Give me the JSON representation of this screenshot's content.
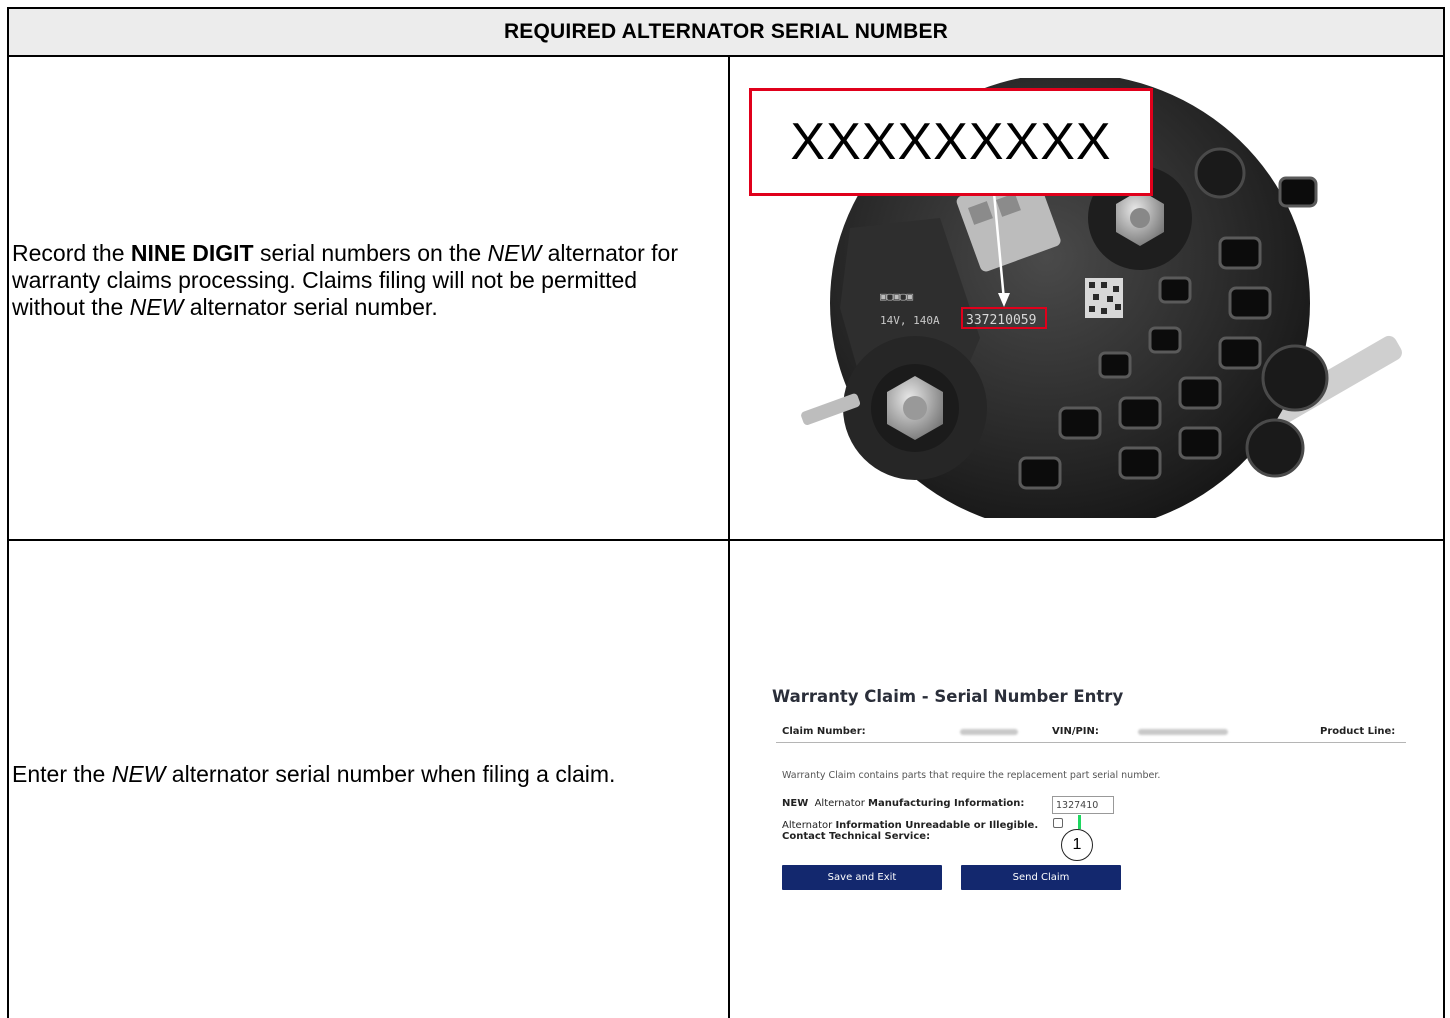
{
  "header": {
    "title": "REQUIRED ALTERNATOR SERIAL NUMBER"
  },
  "row1": {
    "text_a": "Record the ",
    "text_bold": "NINE DIGIT",
    "text_b": " serial numbers on the ",
    "text_new1": "NEW",
    "text_c": " alternator for warranty claims processing. Claims filing will not be permitted without the ",
    "text_new2": "NEW",
    "text_d": " alternator serial number.",
    "callout": "XXXXXXXXX",
    "plate_rating": "14V, 140A",
    "plate_serial": "337210059"
  },
  "row2": {
    "text_a": "Enter the ",
    "text_new": "NEW",
    "text_b": " alternator serial number when filing a claim."
  },
  "screen": {
    "title": "Warranty Claim - Serial Number Entry",
    "claim_number_label": "Claim Number:",
    "vin_label": "VIN/PIN:",
    "product_line_label": "Product Line:",
    "note": "Warranty Claim contains parts that require the replacement part serial number.",
    "new_prefix": "NEW",
    "alternator_word": "Alternator",
    "mfg_info_label": "Manufacturing Information:",
    "serial_value": "1327410",
    "unreadable_label": "Information Unreadable or Illegible. Contact Technical Service:",
    "callout_marker": "1",
    "save_button": "Save and Exit",
    "send_button": "Send Claim"
  },
  "colors": {
    "callout_border": "#e0001b",
    "button_bg": "#13286e",
    "header_bg": "#ececec",
    "marker_line": "#1ed760"
  }
}
